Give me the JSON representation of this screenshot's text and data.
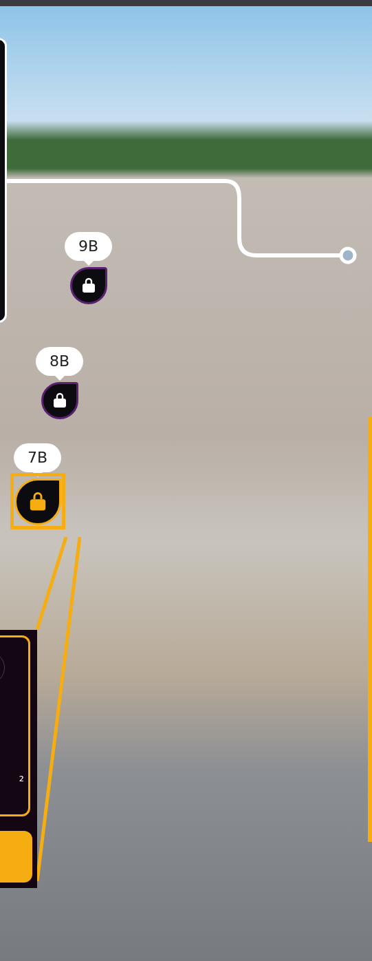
{
  "units": [
    {
      "label": "9B",
      "selected": false
    },
    {
      "label": "8B",
      "selected": false
    },
    {
      "label": "7B",
      "selected": true
    }
  ],
  "detail_panel": {
    "area_fragment": "²"
  }
}
